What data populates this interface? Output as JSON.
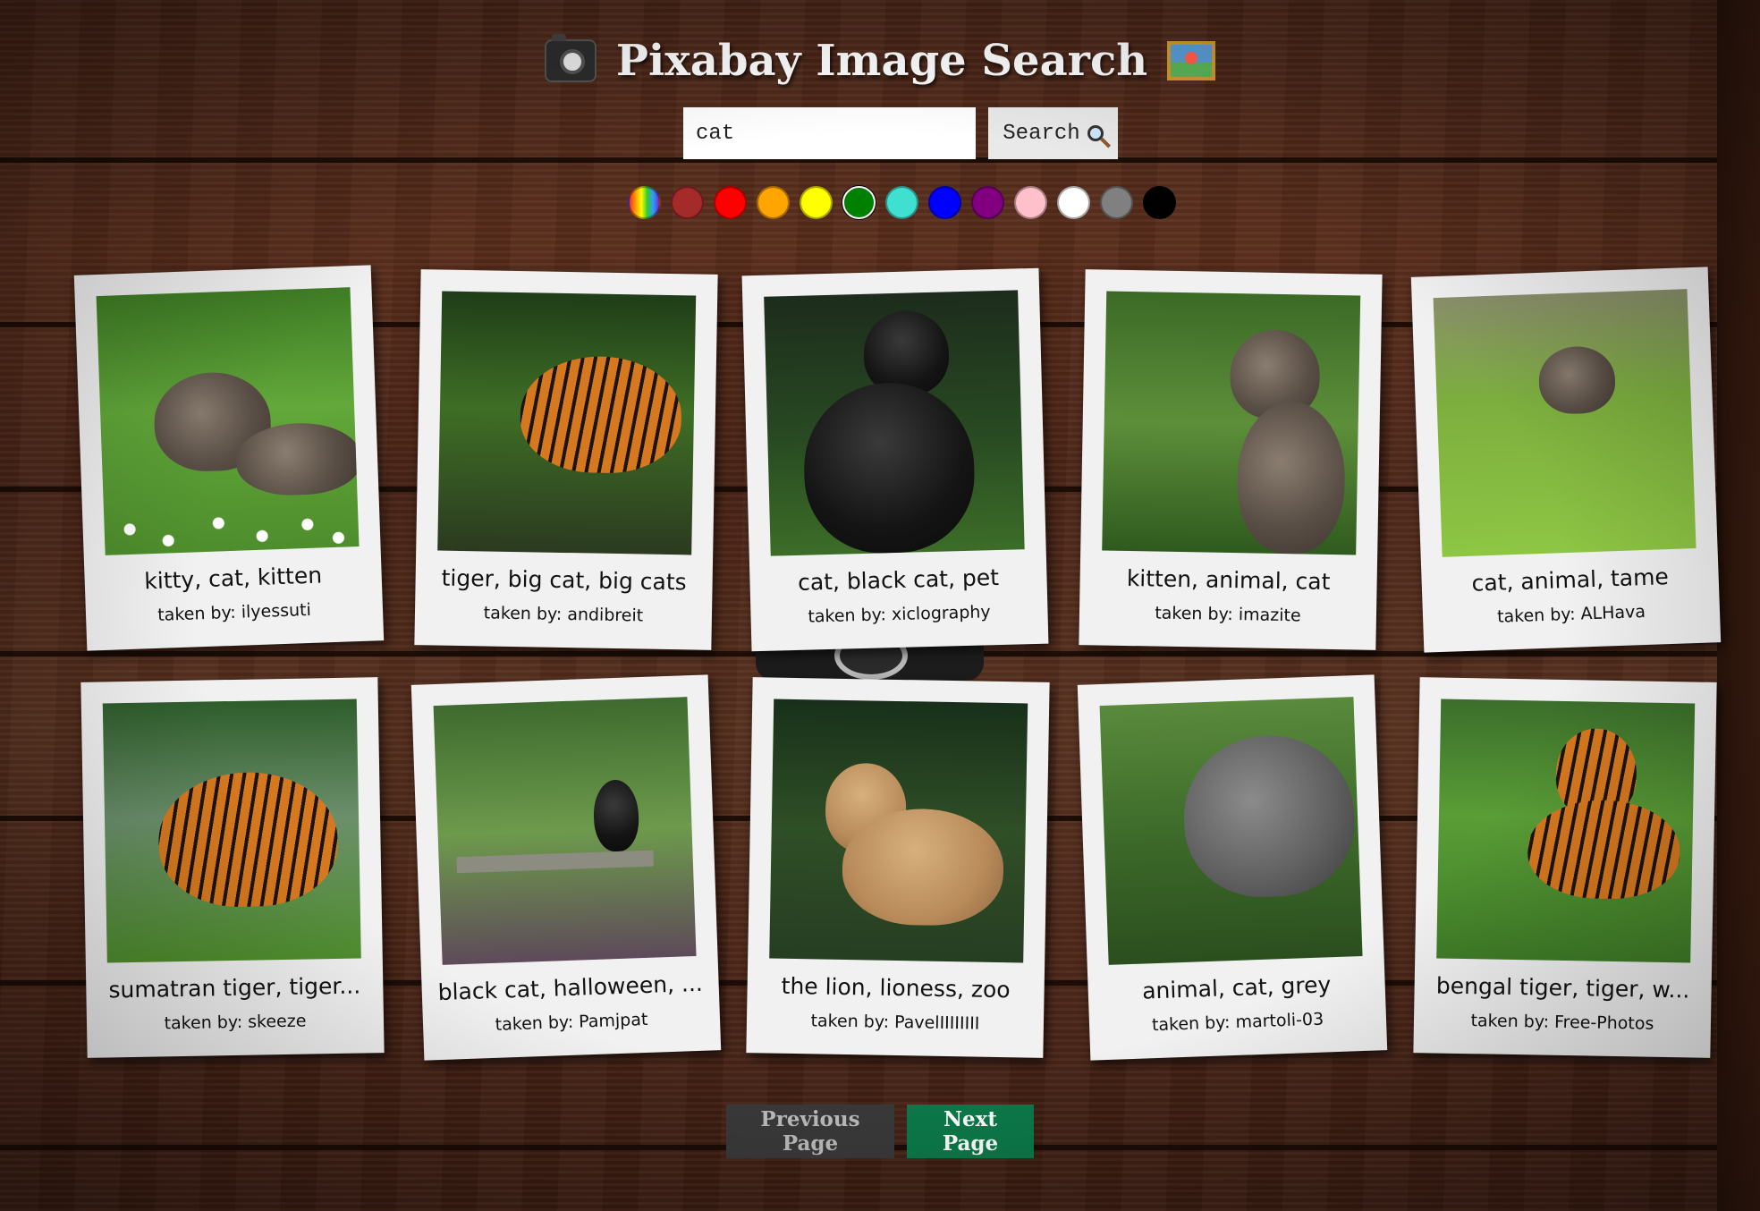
{
  "app": {
    "title": "Pixabay Image Search"
  },
  "search": {
    "value": "cat",
    "button_label": "Search"
  },
  "color_filters": [
    {
      "name": "rainbow",
      "color": "rainbow"
    },
    {
      "name": "brown",
      "color": "#a52a2a"
    },
    {
      "name": "red",
      "color": "#ff0000"
    },
    {
      "name": "orange",
      "color": "#ffa500"
    },
    {
      "name": "yellow",
      "color": "#ffff00"
    },
    {
      "name": "green",
      "color": "#008000",
      "selected": true
    },
    {
      "name": "turquoise",
      "color": "#40e0d0"
    },
    {
      "name": "blue",
      "color": "#0000ff"
    },
    {
      "name": "purple",
      "color": "#800080"
    },
    {
      "name": "pink",
      "color": "#ffc0cb"
    },
    {
      "name": "white",
      "color": "#ffffff"
    },
    {
      "name": "gray",
      "color": "#808080"
    },
    {
      "name": "black",
      "color": "#000000"
    }
  ],
  "results": [
    {
      "tags": "kitty, cat, kitten",
      "author_label": "taken by: ilyessuti",
      "scene": "kitten-grass"
    },
    {
      "tags": "tiger, big cat, big cats",
      "author_label": "taken by: andibreit",
      "scene": "tiger-water"
    },
    {
      "tags": "cat, black cat, pet",
      "author_label": "taken by: xiclography",
      "scene": "black-cat"
    },
    {
      "tags": "kitten, animal, cat",
      "author_label": "taken by: imazite",
      "scene": "kitten-leaves"
    },
    {
      "tags": "cat, animal, tame",
      "author_label": "taken by: ALHava",
      "scene": "kitten-lawn"
    },
    {
      "tags": "sumatran tiger, tiger...",
      "author_label": "taken by: skeeze",
      "scene": "sumatran"
    },
    {
      "tags": "black cat, halloween, ...",
      "author_label": "taken by: Pamjpat",
      "scene": "bench-cat"
    },
    {
      "tags": "the lion, lioness, zoo",
      "author_label": "taken by: PavelIIIIIIII",
      "scene": "lion"
    },
    {
      "tags": "animal, cat, grey",
      "author_label": "taken by: martoli-03",
      "scene": "grey-cat"
    },
    {
      "tags": "bengal tiger, tiger, w...",
      "author_label": "taken by: Free-Photos",
      "scene": "bengal"
    }
  ],
  "pagination": {
    "previous_label": "Previous Page",
    "next_label": "Next Page"
  },
  "colors": {
    "next_button": "#0c7a4a",
    "previous_button": "#3a3a3a",
    "card": "#f1f1f1"
  }
}
